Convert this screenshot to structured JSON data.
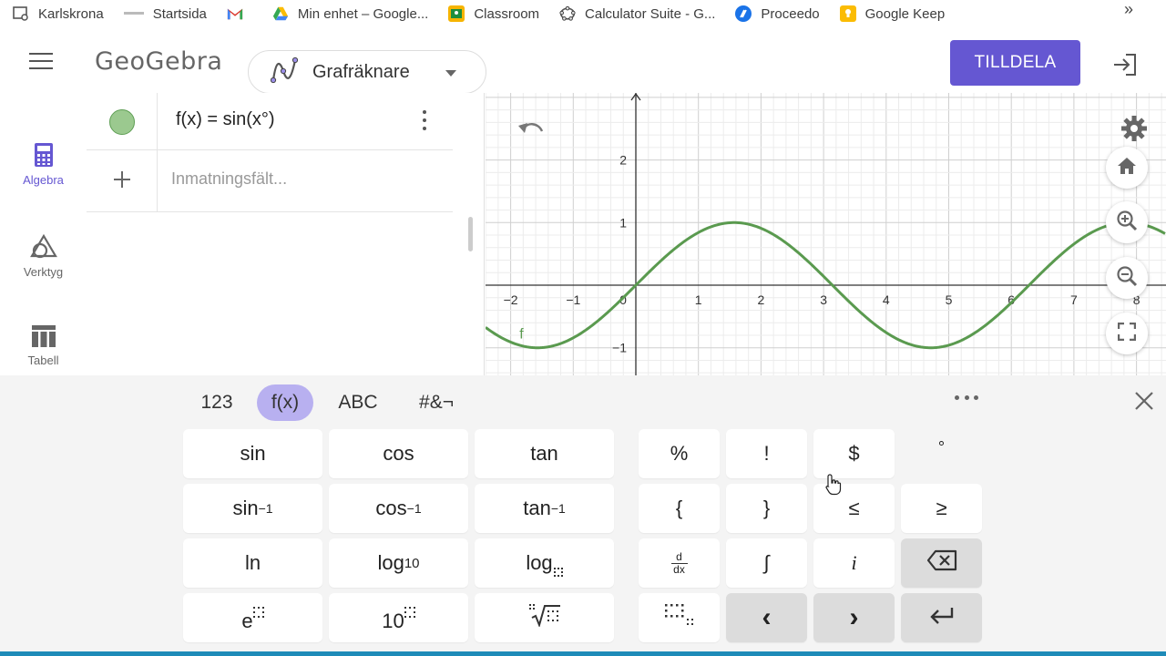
{
  "bookmarks": [
    {
      "label": "Karlskrona",
      "icon": "settings-page-icon"
    },
    {
      "label": "Startsida",
      "icon": "page-icon"
    },
    {
      "label": "",
      "icon": "gmail-icon"
    },
    {
      "label": "Min enhet – Google...",
      "icon": "drive-icon"
    },
    {
      "label": "Classroom",
      "icon": "classroom-icon"
    },
    {
      "label": "Calculator Suite - G...",
      "icon": "geogebra-icon"
    },
    {
      "label": "Proceedo",
      "icon": "proceedo-icon"
    },
    {
      "label": "Google Keep",
      "icon": "keep-icon"
    }
  ],
  "bookmarks_more": "»",
  "header": {
    "logo": "GeoGebra",
    "app_label": "Grafräknare",
    "assign_label": "TILLDELA"
  },
  "sidenav": {
    "items": [
      {
        "label": "Algebra",
        "icon": "calculator-icon",
        "active": true
      },
      {
        "label": "Verktyg",
        "icon": "shapes-icon",
        "active": false
      },
      {
        "label": "Tabell",
        "icon": "table-icon",
        "active": false
      }
    ]
  },
  "algebra": {
    "expression": "f(x) = sin(x°)",
    "input_placeholder": "Inmatningsfält..."
  },
  "graph": {
    "function_label": "f",
    "curve_color": "#5a9a4f",
    "x_ticks": [
      "−2",
      "−1",
      "0",
      "1",
      "2",
      "3",
      "4",
      "5",
      "6",
      "7",
      "8"
    ],
    "y_ticks": [
      "2",
      "1",
      "−1"
    ]
  },
  "keyboard": {
    "tabs": [
      {
        "label": "123",
        "active": false
      },
      {
        "label": "f(x)",
        "active": true
      },
      {
        "label": "ABC",
        "active": false
      },
      {
        "label": "#&¬",
        "active": false
      }
    ],
    "func_keys": {
      "sin": "sin",
      "cos": "cos",
      "tan": "tan",
      "asin": "sin",
      "acos": "cos",
      "atan": "tan",
      "inv": "−1",
      "ln": "ln",
      "log": "log",
      "log_sub": "10",
      "logb": "log",
      "exp": "e",
      "pow10": "10"
    },
    "sym_keys": {
      "percent": "%",
      "excl": "!",
      "dollar": "$",
      "degree": "°",
      "lbrace": "{",
      "rbrace": "}",
      "le": "≤",
      "ge": "≥",
      "integral": "∫",
      "imag": "i",
      "d": "d",
      "dx": "dx",
      "left": "‹",
      "right": "›"
    }
  },
  "colors": {
    "accent": "#6557d2",
    "tab_active": "#b8b0f0",
    "curve": "#5a9a4f",
    "bottom_bar": "#1e8bb8"
  }
}
